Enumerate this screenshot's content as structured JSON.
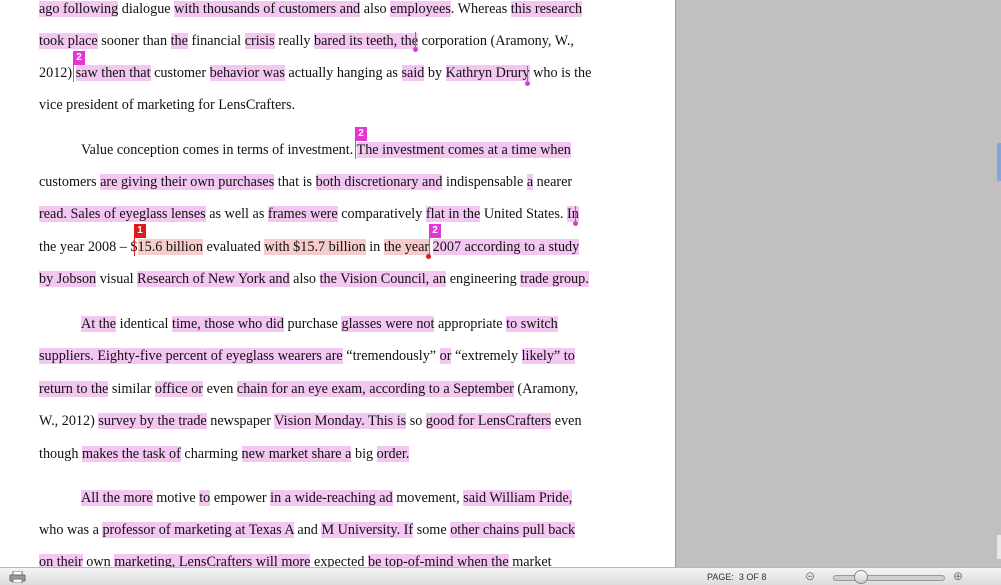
{
  "document": {
    "lines": [
      [
        {
          "t": "ago following",
          "h": "p"
        },
        {
          "t": " dialogue "
        },
        {
          "t": "with thousands of customers and",
          "h": "p"
        },
        {
          "t": " also "
        },
        {
          "t": "employees",
          "h": "p"
        },
        {
          "t": ". Whereas "
        },
        {
          "t": "this research",
          "h": "p"
        }
      ],
      [
        {
          "t": "took place",
          "h": "p"
        },
        {
          "t": " sooner than "
        },
        {
          "t": "the",
          "h": "p"
        },
        {
          "t": " financial "
        },
        {
          "t": "crisis",
          "h": "p"
        },
        {
          "t": " really "
        },
        {
          "t": "bared its teeth, the",
          "h": "p"
        },
        {
          "t": " corporation (Aramony, W.,"
        }
      ],
      [
        {
          "t": "2012) "
        },
        {
          "t": "saw then that",
          "h": "p"
        },
        {
          "t": " customer "
        },
        {
          "t": "behavior was",
          "h": "p"
        },
        {
          "t": " actually hanging as "
        },
        {
          "t": "said",
          "h": "p"
        },
        {
          "t": " by "
        },
        {
          "t": "Kathryn Drury",
          "h": "p"
        },
        {
          "t": " who is the"
        }
      ],
      [
        {
          "t": "vice president of marketing for LensCrafters."
        }
      ],
      [
        {
          "t": "Value conception comes in terms of investment. "
        },
        {
          "t": "The investment comes at a time when",
          "h": "p"
        }
      ],
      [
        {
          "t": "customers "
        },
        {
          "t": "are giving their own purchases",
          "h": "p"
        },
        {
          "t": " that is "
        },
        {
          "t": "both discretionary and",
          "h": "p"
        },
        {
          "t": " indispensable "
        },
        {
          "t": "a",
          "h": "p"
        },
        {
          "t": " nearer"
        }
      ],
      [
        {
          "t": "read. Sales of eyeglass lenses",
          "h": "p"
        },
        {
          "t": " as well as "
        },
        {
          "t": "frames were",
          "h": "p"
        },
        {
          "t": " comparatively "
        },
        {
          "t": "flat in the",
          "h": "p"
        },
        {
          "t": " United States. "
        },
        {
          "t": "In",
          "h": "p"
        }
      ],
      [
        {
          "t": "the year 2008 – $"
        },
        {
          "t": "15.6 billion",
          "h": "r"
        },
        {
          "t": " evaluated "
        },
        {
          "t": "with $15.7 billion",
          "h": "r"
        },
        {
          "t": " in "
        },
        {
          "t": "the year",
          "h": "r"
        },
        {
          "t": " "
        },
        {
          "t": "2007 according to a study",
          "h": "p"
        }
      ],
      [
        {
          "t": "by Jobson",
          "h": "p"
        },
        {
          "t": " visual "
        },
        {
          "t": "Research of New York and",
          "h": "p"
        },
        {
          "t": " also "
        },
        {
          "t": "the Vision Council, an",
          "h": "p"
        },
        {
          "t": " engineering "
        },
        {
          "t": "trade group.",
          "h": "p"
        }
      ],
      [
        {
          "t": "At the",
          "h": "p"
        },
        {
          "t": " identical "
        },
        {
          "t": "time, those who did",
          "h": "p"
        },
        {
          "t": " purchase "
        },
        {
          "t": "glasses were not",
          "h": "p"
        },
        {
          "t": " appropriate "
        },
        {
          "t": "to switch",
          "h": "p"
        }
      ],
      [
        {
          "t": "suppliers. Eighty-five percent of eyeglass wearers are",
          "h": "p"
        },
        {
          "t": " “tremendously” "
        },
        {
          "t": "or",
          "h": "p"
        },
        {
          "t": " “extremely "
        },
        {
          "t": "likely” to",
          "h": "p"
        }
      ],
      [
        {
          "t": "return to the",
          "h": "p"
        },
        {
          "t": " similar "
        },
        {
          "t": "office or",
          "h": "p"
        },
        {
          "t": " even "
        },
        {
          "t": "chain for an eye exam, according to a September",
          "h": "p"
        },
        {
          "t": " (Aramony,"
        }
      ],
      [
        {
          "t": "W., 2012) "
        },
        {
          "t": "survey by the trade",
          "h": "p"
        },
        {
          "t": " newspaper "
        },
        {
          "t": "Vision Monday. This is",
          "h": "p"
        },
        {
          "t": " so "
        },
        {
          "t": "good for LensCrafters",
          "h": "p"
        },
        {
          "t": " even"
        }
      ],
      [
        {
          "t": "though "
        },
        {
          "t": "makes the task of",
          "h": "p"
        },
        {
          "t": " charming "
        },
        {
          "t": "new market share a",
          "h": "p"
        },
        {
          "t": " big "
        },
        {
          "t": "order.",
          "h": "p"
        }
      ],
      [
        {
          "t": "All the more",
          "h": "p"
        },
        {
          "t": " motive "
        },
        {
          "t": "to",
          "h": "p"
        },
        {
          "t": " empower "
        },
        {
          "t": "in a wide-reaching ad",
          "h": "p"
        },
        {
          "t": " movement, "
        },
        {
          "t": "said William Pride,",
          "h": "p"
        }
      ],
      [
        {
          "t": "who was a "
        },
        {
          "t": "professor of marketing at Texas A",
          "h": "p"
        },
        {
          "t": " and "
        },
        {
          "t": "M University. If",
          "h": "p"
        },
        {
          "t": " some "
        },
        {
          "t": "other chains pull back",
          "h": "p"
        }
      ],
      [
        {
          "t": "on their",
          "h": "p"
        },
        {
          "t": " own "
        },
        {
          "t": "marketing, LensCrafters will more",
          "h": "p"
        },
        {
          "t": " expected "
        },
        {
          "t": "be top-of-mind when the",
          "h": "p"
        },
        {
          "t": " market"
        }
      ]
    ],
    "markers": [
      {
        "label": "2",
        "kind": "pink"
      },
      {
        "label": "2",
        "kind": "pink"
      },
      {
        "label": "1",
        "kind": "red"
      },
      {
        "label": "2",
        "kind": "pink"
      }
    ]
  },
  "statusbar": {
    "page_label": "PAGE:",
    "page_value": "3 OF 8",
    "zoom_out_icon": "zoom-out-icon",
    "zoom_in_icon": "zoom-in-icon",
    "print_icon": "printer-icon"
  },
  "colors": {
    "highlight_pink": "#f4c6f2",
    "highlight_red": "#f6cccc",
    "marker_pink": "#e535d6",
    "marker_red": "#e01a1a"
  }
}
